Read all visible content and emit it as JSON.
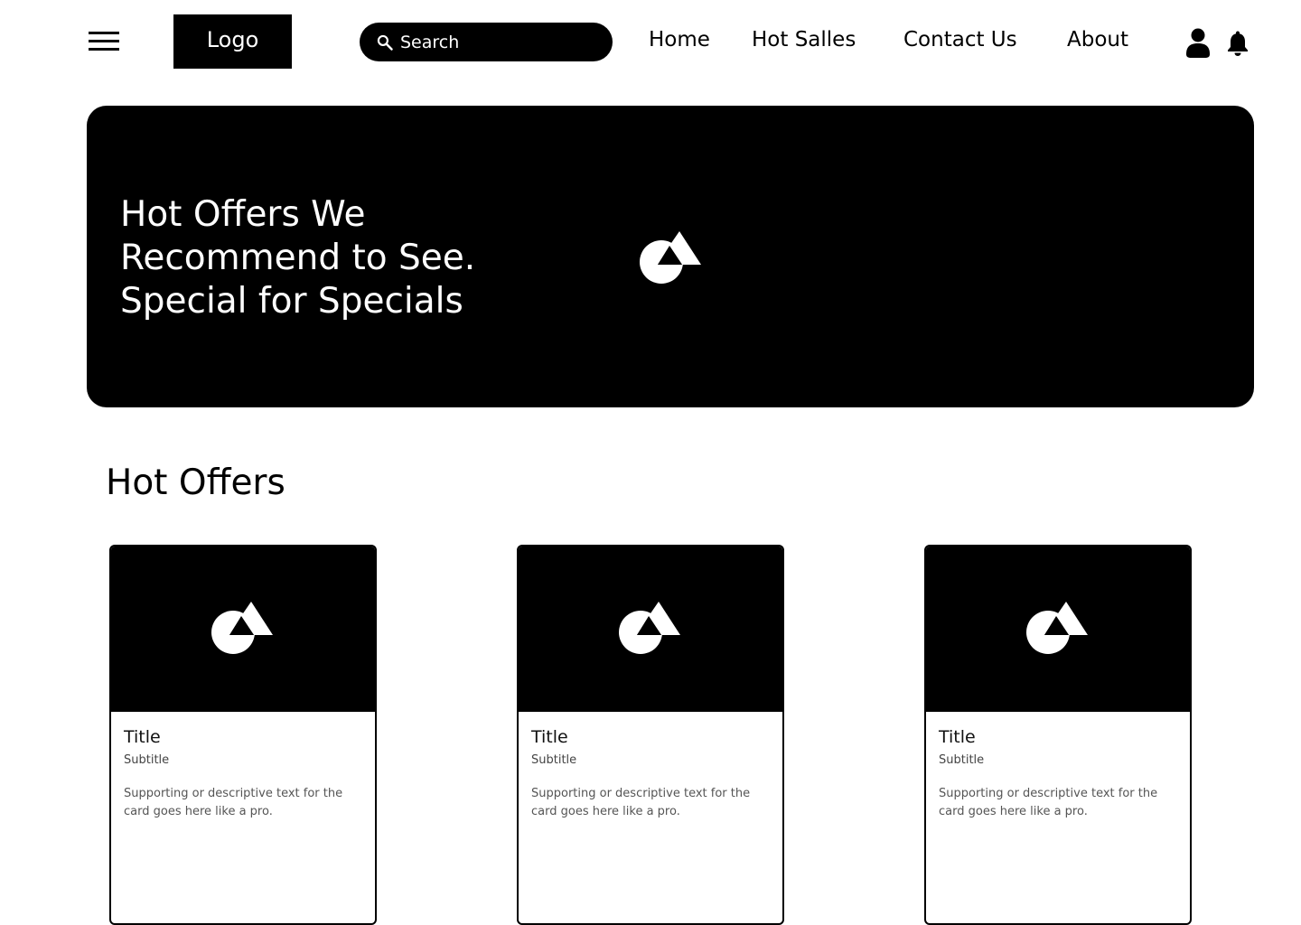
{
  "header": {
    "logo_label": "Logo",
    "search": {
      "placeholder": "Search",
      "value": ""
    },
    "nav": {
      "home": "Home",
      "hot_sales": "Hot Salles",
      "contact": "Contact Us",
      "about": "About"
    },
    "icons": {
      "menu": "hamburger-menu-icon",
      "search": "search-icon",
      "user": "user-icon",
      "notifications": "bell-icon"
    }
  },
  "hero": {
    "title_lines": [
      "Hot Offers We",
      "Recommend to See.",
      "Special for Specials"
    ],
    "image_icon": "image-placeholder-icon"
  },
  "section": {
    "title": "Hot Offers"
  },
  "cards": [
    {
      "title": "Title",
      "subtitle": "Subtitle",
      "text": "Supporting or descriptive text for the card goes here like a pro."
    },
    {
      "title": "Title",
      "subtitle": "Subtitle",
      "text": "Supporting or descriptive text for the card goes here like a pro."
    },
    {
      "title": "Title",
      "subtitle": "Subtitle",
      "text": "Supporting or descriptive text for the card goes here like a pro."
    }
  ],
  "colors": {
    "primary": "#000000",
    "background": "#ffffff",
    "on_primary": "#ffffff"
  }
}
